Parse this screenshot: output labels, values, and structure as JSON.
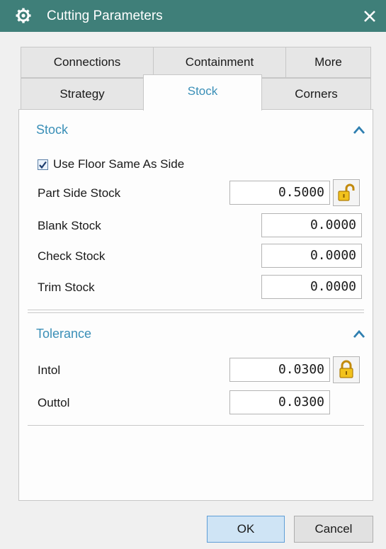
{
  "window": {
    "title": "Cutting Parameters",
    "icon": "gear-icon",
    "close_icon": "close-icon"
  },
  "tabs": {
    "row1": [
      {
        "label": "Connections"
      },
      {
        "label": "Containment"
      },
      {
        "label": "More"
      }
    ],
    "row2": [
      {
        "label": "Strategy"
      },
      {
        "label": "Stock",
        "active": true
      },
      {
        "label": "Corners"
      }
    ]
  },
  "stock": {
    "title": "Stock",
    "use_floor_same_as_side": {
      "label": "Use Floor Same As Side",
      "checked": true
    },
    "part_side_stock": {
      "label": "Part Side Stock",
      "value": "0.5000",
      "lock": "unlocked"
    },
    "blank_stock": {
      "label": "Blank Stock",
      "value": "0.0000"
    },
    "check_stock": {
      "label": "Check Stock",
      "value": "0.0000"
    },
    "trim_stock": {
      "label": "Trim Stock",
      "value": "0.0000"
    }
  },
  "tolerance": {
    "title": "Tolerance",
    "intol": {
      "label": "Intol",
      "value": "0.0300",
      "lock": "locked"
    },
    "outtol": {
      "label": "Outtol",
      "value": "0.0300"
    }
  },
  "buttons": {
    "ok": "OK",
    "cancel": "Cancel"
  },
  "colors": {
    "titlebar": "#3f7f79",
    "accent": "#3a8fb7",
    "lock": "#e6b319"
  }
}
